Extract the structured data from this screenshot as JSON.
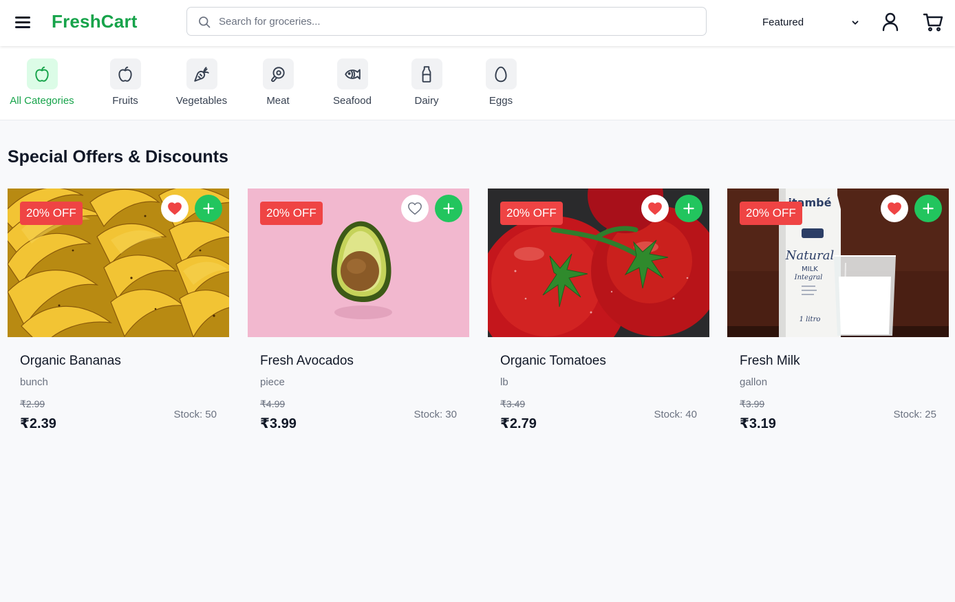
{
  "header": {
    "logo": "FreshCart",
    "search_placeholder": "Search for groceries...",
    "sort_selected": "Featured",
    "icons": [
      "menu-icon",
      "search-icon",
      "chevron-down-icon",
      "user-icon",
      "cart-icon"
    ]
  },
  "categories": [
    {
      "label": "All Categories",
      "icon": "apple-icon",
      "active": true
    },
    {
      "label": "Fruits",
      "icon": "apple-icon",
      "active": false
    },
    {
      "label": "Vegetables",
      "icon": "carrot-icon",
      "active": false
    },
    {
      "label": "Meat",
      "icon": "beef-icon",
      "active": false
    },
    {
      "label": "Seafood",
      "icon": "fish-icon",
      "active": false
    },
    {
      "label": "Dairy",
      "icon": "milk-icon",
      "active": false
    },
    {
      "label": "Eggs",
      "icon": "egg-icon",
      "active": false
    }
  ],
  "section": {
    "title": "Special Offers & Discounts"
  },
  "colors": {
    "brand": "#16a34a",
    "discount": "#ef4444",
    "add": "#22c55e",
    "heart": "#ef4444"
  },
  "products": [
    {
      "name": "Organic Bananas",
      "unit": "bunch",
      "old_price": "₹2.99",
      "price": "₹2.39",
      "stock": "Stock: 50",
      "discount": "20% OFF",
      "favorited": true
    },
    {
      "name": "Fresh Avocados",
      "unit": "piece",
      "old_price": "₹4.99",
      "price": "₹3.99",
      "stock": "Stock: 30",
      "discount": "20% OFF",
      "favorited": false
    },
    {
      "name": "Organic Tomatoes",
      "unit": "lb",
      "old_price": "₹3.49",
      "price": "₹2.79",
      "stock": "Stock: 40",
      "discount": "20% OFF",
      "favorited": true
    },
    {
      "name": "Fresh Milk",
      "unit": "gallon",
      "old_price": "₹3.99",
      "price": "₹3.19",
      "stock": "Stock: 25",
      "discount": "20% OFF",
      "favorited": true
    }
  ],
  "milk_image_text": {
    "brand": "itambé",
    "line1": "Natural",
    "line2": "MILK",
    "line3": "Integral",
    "line4": "1 litro"
  }
}
